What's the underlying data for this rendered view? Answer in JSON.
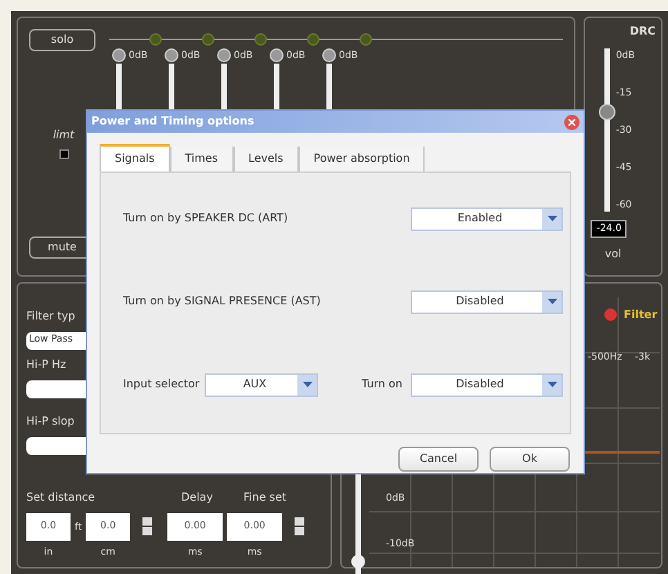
{
  "mixer": {
    "solo_button": "solo",
    "bands": [
      {
        "label": "0dB"
      },
      {
        "label": "0dB"
      },
      {
        "label": "0dB"
      },
      {
        "label": "0dB"
      },
      {
        "label": "0dB"
      }
    ],
    "limit_label": "limt",
    "mute_button": "mute"
  },
  "drc": {
    "title": "DRC",
    "scale": [
      "0dB",
      "-15",
      "-30",
      "-45",
      "-60"
    ],
    "level": 0.62,
    "value": "-24.0",
    "label": "vol"
  },
  "filter": {
    "filter_type_label": "Filter typ",
    "filter_type_value": "Low Pass",
    "hip_hz_label": "Hi-P Hz",
    "hip_slope_label": "Hi-P slop",
    "distance_label": "Set distance",
    "delay_label": "Delay",
    "fine_set_label": "Fine set",
    "separator": "ft",
    "fields": [
      {
        "value": "0.0",
        "unit": "in"
      },
      {
        "value": "0.0",
        "unit": "cm"
      },
      {
        "value": "0.00",
        "unit": "ms"
      },
      {
        "value": "0.00",
        "unit": "ms"
      }
    ]
  },
  "graph": {
    "filter_label": "Filter",
    "freq_labels": [
      "-500Hz",
      "-3k"
    ],
    "db_labels": [
      "0dB",
      "-10dB"
    ]
  },
  "dialog": {
    "title": "Power and Timing options",
    "tabs": [
      {
        "label": "Signals",
        "selected": true
      },
      {
        "label": "Times",
        "selected": false
      },
      {
        "label": "Levels",
        "selected": false
      },
      {
        "label": "Power absorption",
        "selected": false
      }
    ],
    "rows": [
      {
        "fields": [
          {
            "label": "Turn on by SPEAKER DC (ART)",
            "value": "Enabled"
          }
        ]
      },
      {
        "fields": [
          {
            "label": "Turn on by SIGNAL PRESENCE (AST)",
            "value": "Disabled"
          }
        ]
      },
      {
        "fields": [
          {
            "label": "Input selector",
            "value": "AUX"
          },
          {
            "label": "Turn on",
            "value": "Disabled"
          }
        ]
      }
    ],
    "buttons": [
      "Cancel",
      "Ok"
    ]
  }
}
